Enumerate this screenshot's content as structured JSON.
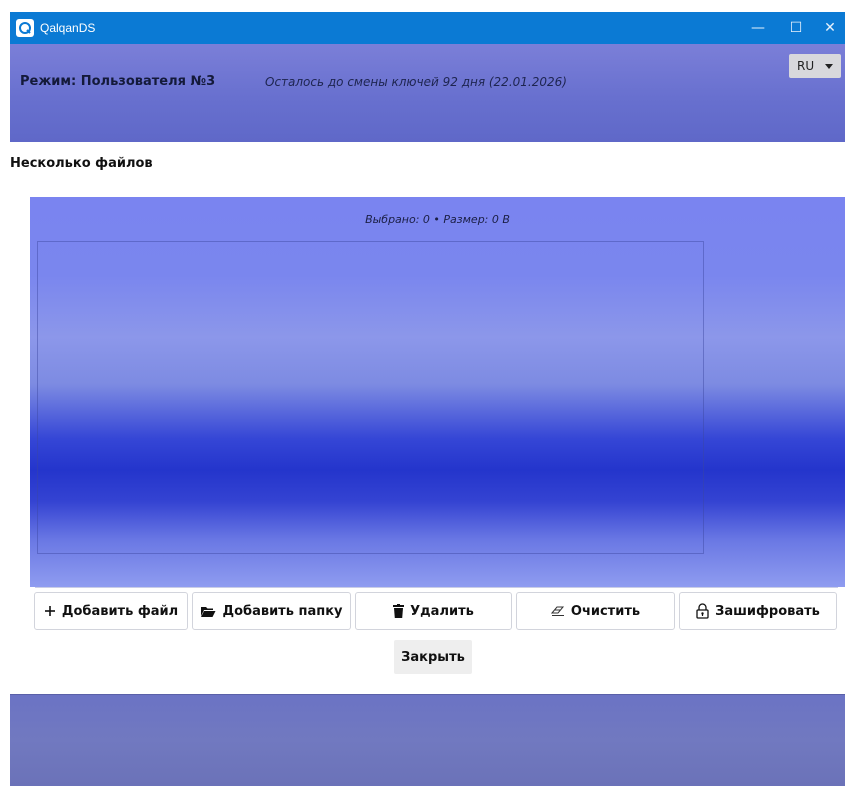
{
  "window": {
    "title": "QalqanDS",
    "controls": {
      "minimize": "—",
      "maximize": "☐",
      "close": "✕"
    }
  },
  "header": {
    "mode_label": "Режим: Пользователя №3",
    "keys_notice": "Осталось до смены ключей 92 дня (22.01.2026)",
    "language": "RU"
  },
  "section": {
    "title": "Несколько файлов"
  },
  "panel": {
    "selected_info": "Выбрано: 0 • Размер: 0 B"
  },
  "actions": {
    "add_file": "Добавить файл",
    "add_folder": "Добавить папку",
    "delete": "Удалить",
    "clear": "Очистить",
    "encrypt": "Зашифровать"
  },
  "close_label": "Закрыть",
  "colors": {
    "titlebar": "#0b7ad4",
    "header": "#6870cf",
    "panel_deep": "#2435cc"
  }
}
